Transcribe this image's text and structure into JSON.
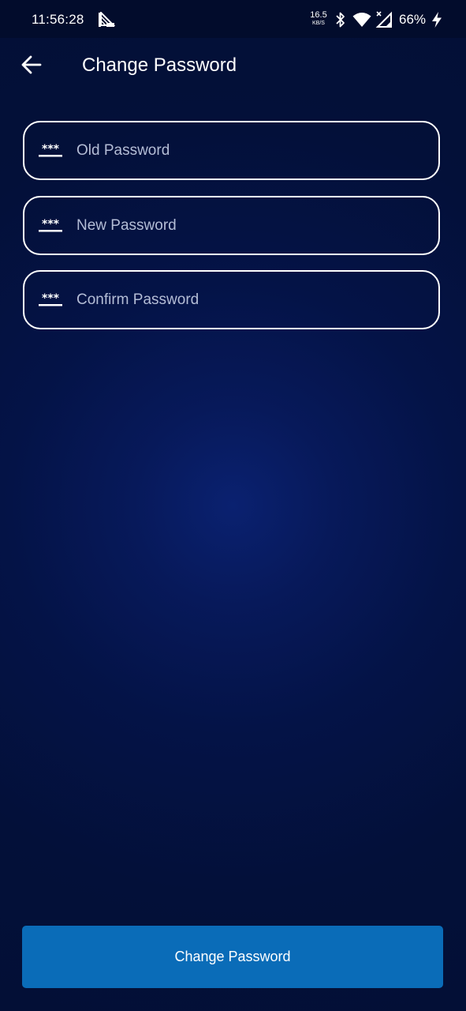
{
  "status_bar": {
    "time": "11:56:28",
    "net_speed_value": "16.5",
    "net_speed_unit": "KB/S",
    "battery": "66%",
    "icons": [
      "notification-icon",
      "bluetooth-icon",
      "wifi-icon",
      "signal-icon",
      "charging-icon"
    ]
  },
  "header": {
    "back_icon": "arrow-left-icon",
    "title": "Change Password"
  },
  "form": {
    "fields": [
      {
        "icon": "password-dots-icon",
        "placeholder": "Old Password",
        "value": ""
      },
      {
        "icon": "password-dots-icon",
        "placeholder": "New Password",
        "value": ""
      },
      {
        "icon": "password-dots-icon",
        "placeholder": "Confirm Password",
        "value": ""
      }
    ],
    "submit_label": "Change Password"
  },
  "colors": {
    "background": "#041347",
    "status_bar": "#020c2c",
    "button": "#0a6cb8",
    "field_border": "#ffffff",
    "placeholder": "#b4bdd6"
  }
}
